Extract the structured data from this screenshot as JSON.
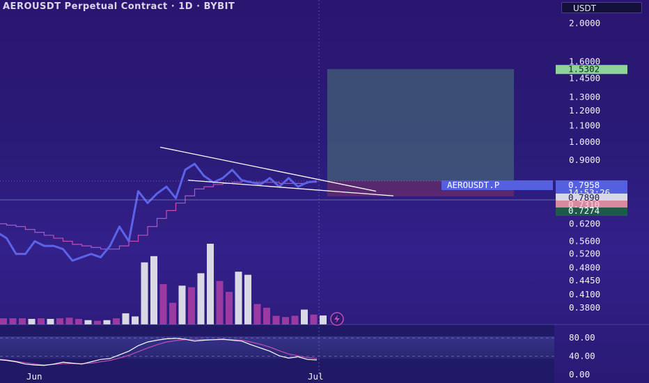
{
  "header": {
    "title": "AEROUSDT Perpetual Contract · 1D · BYBIT",
    "currency": "USDT"
  },
  "colors": {
    "price_line": "#5b63e8",
    "ma_line": "#c04fb4",
    "trend_line": "#ffffff",
    "target_zone": "#3f5877",
    "stop_zone": "#5d2a6e",
    "volume_up": "#d9d9e6",
    "volume_down": "#9b3aa0",
    "rsi_line": "#ffffff",
    "rsi_ma": "#c04fb4",
    "target_tag": "#8fd29a",
    "symbol_tag": "#5560e0",
    "stop_tag": "#d989a0",
    "entry_tag": "#1d5a4a"
  },
  "chart_data": {
    "type": "line",
    "title": "AEROUSDT Perpetual Contract · 1D · BYBIT",
    "y_scale": "log",
    "ylim": [
      0.35,
      2.2
    ],
    "y_ticks": [
      "2.0000",
      "1.6000",
      "1.4500",
      "1.3000",
      "1.2000",
      "1.1000",
      "1.0000",
      "0.9000",
      "0.6200",
      "0.5600",
      "0.5200",
      "0.4800",
      "0.4450",
      "0.4100",
      "0.3800"
    ],
    "x_labels": [
      "Jun",
      "Jul"
    ],
    "price_series": [
      0.59,
      0.57,
      0.52,
      0.52,
      0.56,
      0.545,
      0.545,
      0.535,
      0.5,
      0.51,
      0.52,
      0.51,
      0.545,
      0.61,
      0.56,
      0.75,
      0.7,
      0.74,
      0.77,
      0.72,
      0.85,
      0.88,
      0.82,
      0.79,
      0.81,
      0.85,
      0.8,
      0.79,
      0.78,
      0.81,
      0.77,
      0.81,
      0.77,
      0.79,
      0.795
    ],
    "ma_series": [
      0.62,
      0.615,
      0.61,
      0.6,
      0.59,
      0.58,
      0.57,
      0.56,
      0.55,
      0.545,
      0.54,
      0.535,
      0.535,
      0.545,
      0.56,
      0.58,
      0.61,
      0.64,
      0.67,
      0.7,
      0.73,
      0.76,
      0.77,
      0.78,
      0.785,
      0.79,
      0.795,
      0.79,
      0.79,
      0.79,
      0.785,
      0.785,
      0.785,
      0.79,
      0.79
    ],
    "volume": [
      2,
      2,
      2,
      1.8,
      2,
      1.8,
      2,
      2.2,
      1.8,
      1.4,
      1.2,
      1.4,
      2,
      3.6,
      2.6,
      20,
      22,
      13,
      7,
      12.5,
      12,
      16.5,
      26,
      14,
      10.5,
      17,
      16,
      6.6,
      5.4,
      2.8,
      2.4,
      2.8,
      4.8,
      3.2,
      2.9
    ],
    "volume_up": [
      false,
      false,
      false,
      true,
      false,
      true,
      false,
      false,
      false,
      true,
      false,
      true,
      false,
      true,
      true,
      true,
      true,
      false,
      false,
      true,
      false,
      true,
      true,
      false,
      false,
      true,
      true,
      false,
      false,
      false,
      false,
      false,
      true,
      false,
      true
    ],
    "triangle_upper": {
      "from": 0.97,
      "to": 0.75
    },
    "triangle_lower": {
      "from": 0.8,
      "to": 0.73
    },
    "long_position": {
      "entry": 0.7958,
      "target": 1.5302,
      "stop": 0.7274
    },
    "rsi": {
      "ticks": [
        "80.00",
        "40.00",
        "0.00"
      ],
      "ylim": [
        0,
        100
      ],
      "values": [
        30,
        28,
        25,
        20,
        18,
        17,
        20,
        24,
        22,
        20,
        25,
        30,
        32,
        40,
        48,
        60,
        68,
        72,
        75,
        76,
        74,
        70,
        72,
        73,
        74,
        72,
        70,
        62,
        55,
        48,
        38,
        33,
        36,
        30,
        29
      ],
      "ma_values": [
        31,
        29,
        26,
        23,
        20,
        18,
        19,
        21,
        21,
        21,
        22,
        25,
        28,
        33,
        39,
        47,
        55,
        62,
        68,
        71,
        73,
        73,
        73,
        73,
        73,
        73,
        72,
        68,
        63,
        57,
        49,
        42,
        38,
        34,
        32
      ]
    },
    "price_tags": {
      "target": "1.5302",
      "symbol": "AEROUSDT.P",
      "price": "0.7958",
      "countdown": "14:53:26",
      "entry": "0.7890",
      "stop": "0.7310",
      "low": "0.7274"
    }
  }
}
